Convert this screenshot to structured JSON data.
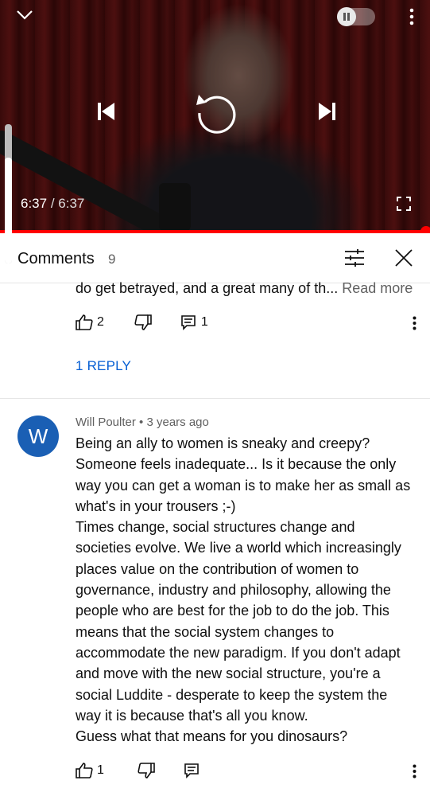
{
  "player": {
    "current_time": "6:37",
    "separator": "/",
    "duration": "6:37",
    "progress_fraction": 1.0,
    "icons": [
      "chevron-down-icon",
      "pause-icon",
      "more-vert-icon",
      "skip-previous-icon",
      "replay-icon",
      "skip-next-icon",
      "fullscreen-icon"
    ]
  },
  "comments_panel": {
    "title": "Comments",
    "count": "9",
    "icons": [
      "sort-filter-icon",
      "close-icon"
    ]
  },
  "comment_1": {
    "text_tail": "do get betrayed, and a great many of th...",
    "read_more": "Read more",
    "like_count": "2",
    "reply_count": "1",
    "replies_link": "1 REPLY"
  },
  "comment_2": {
    "avatar_letter": "W",
    "author": "Will Poulter",
    "dot": "•",
    "time": "3 years ago",
    "lines": [
      "Being an ally to women is sneaky and creepy?",
      "Someone feels inadequate... Is it because the only",
      "way you can get a woman is to make her as small as",
      "what's in your trousers ;-)",
      "Times change, social structures change and",
      "societies evolve. We live a world which increasingly",
      "places value on the contribution of women to",
      "governance, industry and philosophy, allowing the",
      "people who are best for the job to do the job. This",
      "means that the social system changes to",
      "accommodate the new paradigm. If you don't adapt",
      "and move with the new social structure, you're a",
      "social Luddite - desperate to keep the system the",
      "way it is because that's all you know.",
      "Guess what that means for you dinosaurs?"
    ],
    "like_count": "1",
    "avatar_color": "#1a5fb4"
  }
}
